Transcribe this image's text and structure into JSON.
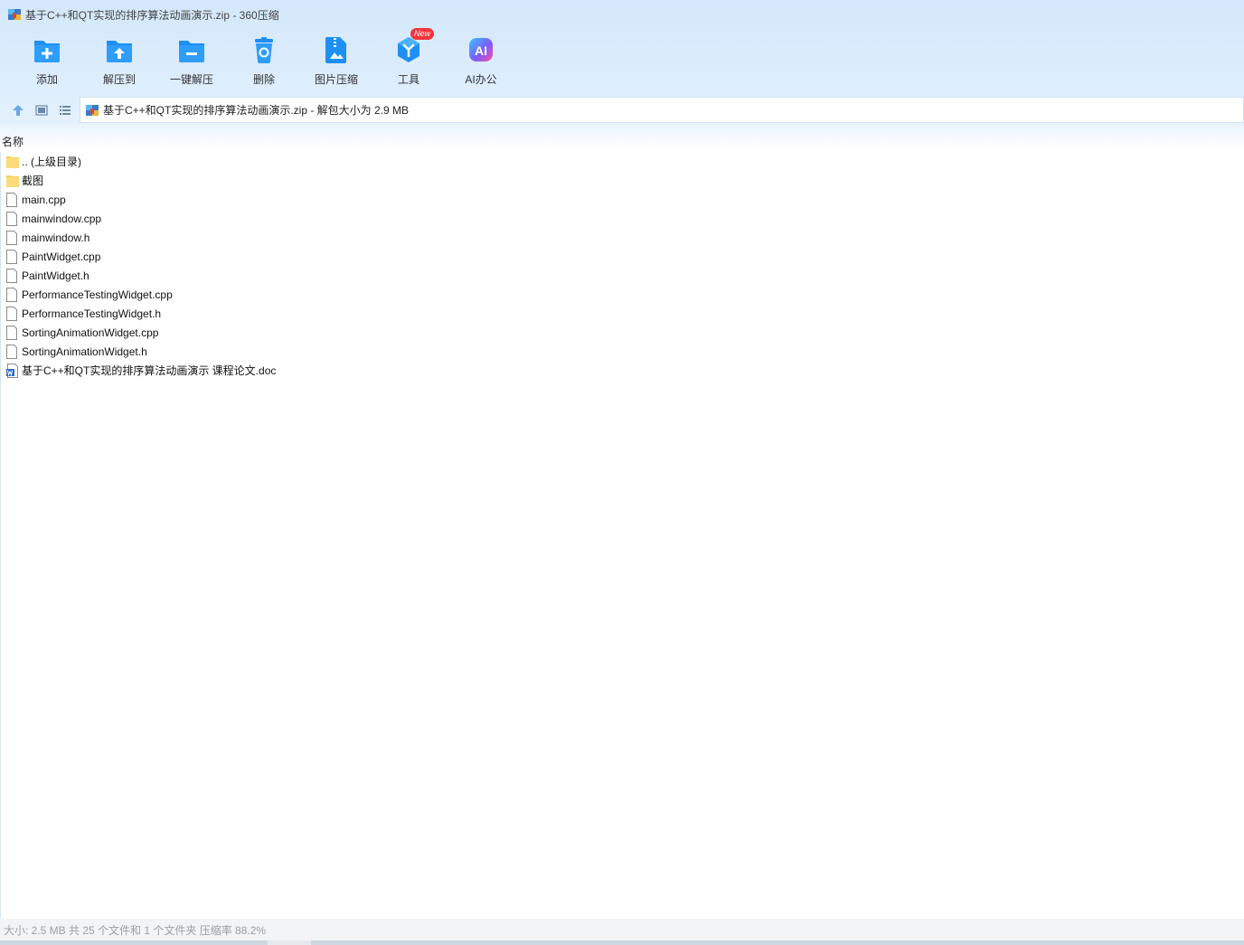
{
  "window": {
    "title": "基于C++和QT实现的排序算法动画演示.zip - 360压缩"
  },
  "toolbar": {
    "items": [
      {
        "label": "添加",
        "icon": "add-icon"
      },
      {
        "label": "解压到",
        "icon": "extract-to-icon"
      },
      {
        "label": "一键解压",
        "icon": "one-click-extract-icon"
      },
      {
        "label": "删除",
        "icon": "delete-icon"
      },
      {
        "label": "图片压缩",
        "icon": "image-compress-icon"
      },
      {
        "label": "工具",
        "icon": "tools-icon",
        "badge": "New"
      },
      {
        "label": "AI办公",
        "icon": "ai-office-icon"
      }
    ]
  },
  "address": {
    "text": "基于C++和QT实现的排序算法动画演示.zip - 解包大小为 2.9 MB"
  },
  "list": {
    "column_name": "名称",
    "rows": [
      {
        "name": ".. (上级目录)",
        "type": "folder"
      },
      {
        "name": "截图",
        "type": "folder"
      },
      {
        "name": "main.cpp",
        "type": "file"
      },
      {
        "name": "mainwindow.cpp",
        "type": "file"
      },
      {
        "name": "mainwindow.h",
        "type": "file"
      },
      {
        "name": "PaintWidget.cpp",
        "type": "file"
      },
      {
        "name": "PaintWidget.h",
        "type": "file"
      },
      {
        "name": "PerformanceTestingWidget.cpp",
        "type": "file"
      },
      {
        "name": "PerformanceTestingWidget.h",
        "type": "file"
      },
      {
        "name": "SortingAnimationWidget.cpp",
        "type": "file"
      },
      {
        "name": "SortingAnimationWidget.h",
        "type": "file"
      },
      {
        "name": "基于C++和QT实现的排序算法动画演示 课程论文.doc",
        "type": "doc"
      }
    ]
  },
  "status": {
    "text": "大小: 2.5 MB 共 25 个文件和 1 个文件夹 压缩率 88.2%"
  },
  "colors": {
    "accent": "#1e8ff5",
    "folder": "#f7cf5b",
    "badge": "#f0353c"
  }
}
